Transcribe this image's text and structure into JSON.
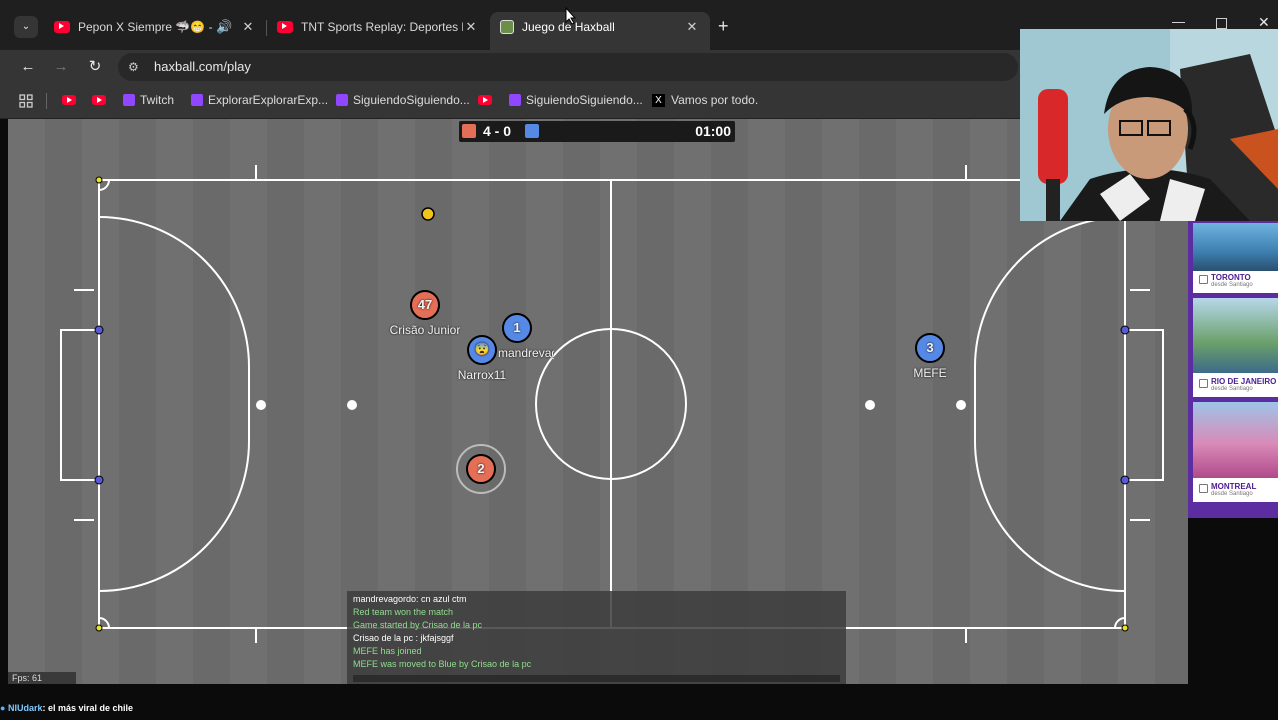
{
  "tabs": [
    {
      "label": "Pepon X Siempre 🦈😁 - Ja",
      "favicon": "youtube-icon",
      "audio": true
    },
    {
      "label": "TNT Sports Replay: Deportes lq",
      "favicon": "youtube-icon"
    },
    {
      "label": "Juego de Haxball",
      "favicon": "haxball-icon",
      "active": true
    }
  ],
  "toolbar": {
    "url": "haxball.com/play"
  },
  "bookmarks": [
    {
      "label": "",
      "icon": "youtube-icon"
    },
    {
      "label": "",
      "icon": "youtube-icon"
    },
    {
      "label": "Twitch",
      "icon": "twitch-icon"
    },
    {
      "label": "ExplorarExplorarExp...",
      "icon": "twitch-icon"
    },
    {
      "label": "SiguiendoSiguiendo...",
      "icon": "twitch-icon"
    },
    {
      "label": "",
      "icon": "youtube-icon"
    },
    {
      "label": "SiguiendoSiguiendo...",
      "icon": "twitch-icon"
    },
    {
      "label": "Vamos por todo.",
      "icon": "x-icon"
    }
  ],
  "scoreboard": {
    "score": "4 - 0",
    "time": "01:00",
    "red_color": "#e56e56",
    "blue_color": "#5689e5"
  },
  "players": [
    {
      "number": "47",
      "name": "Crisão Junior",
      "team": "red"
    },
    {
      "number": "1",
      "name": "mandrevagordo",
      "team": "blue"
    },
    {
      "number": "😨",
      "name": "Narrox11",
      "team": "blue"
    },
    {
      "number": "2",
      "name": "",
      "team": "red"
    },
    {
      "number": "3",
      "name": "MEFE",
      "team": "blue"
    }
  ],
  "chat": [
    {
      "text": "mandrevagordo: cn azul ctm",
      "kind": "player"
    },
    {
      "text": "Red team won the match",
      "kind": "system"
    },
    {
      "text": "Game started by Crisao de la pc",
      "kind": "system"
    },
    {
      "text": "Crisao de la pc : jkfajsggf",
      "kind": "player"
    },
    {
      "text": "MEFE has joined",
      "kind": "system"
    },
    {
      "text": "MEFE was moved to Blue by Crisao de la pc",
      "kind": "system"
    }
  ],
  "fps": "Fps: 61",
  "footer": {
    "user": "NIUdark",
    "message": ": el más viral de chile"
  },
  "ads": [
    {
      "city": "TORONTO",
      "sub": "desde Santiago"
    },
    {
      "city": "RIO DE JANEIRO",
      "sub": "desde Santiago"
    },
    {
      "city": "MONTREAL",
      "sub": "desde Santiago"
    }
  ],
  "colors": {
    "red_team": "#e56e56",
    "blue_team": "#5689e5",
    "system_chat": "#8fdc8f",
    "pitch": "#6e6e6e"
  }
}
